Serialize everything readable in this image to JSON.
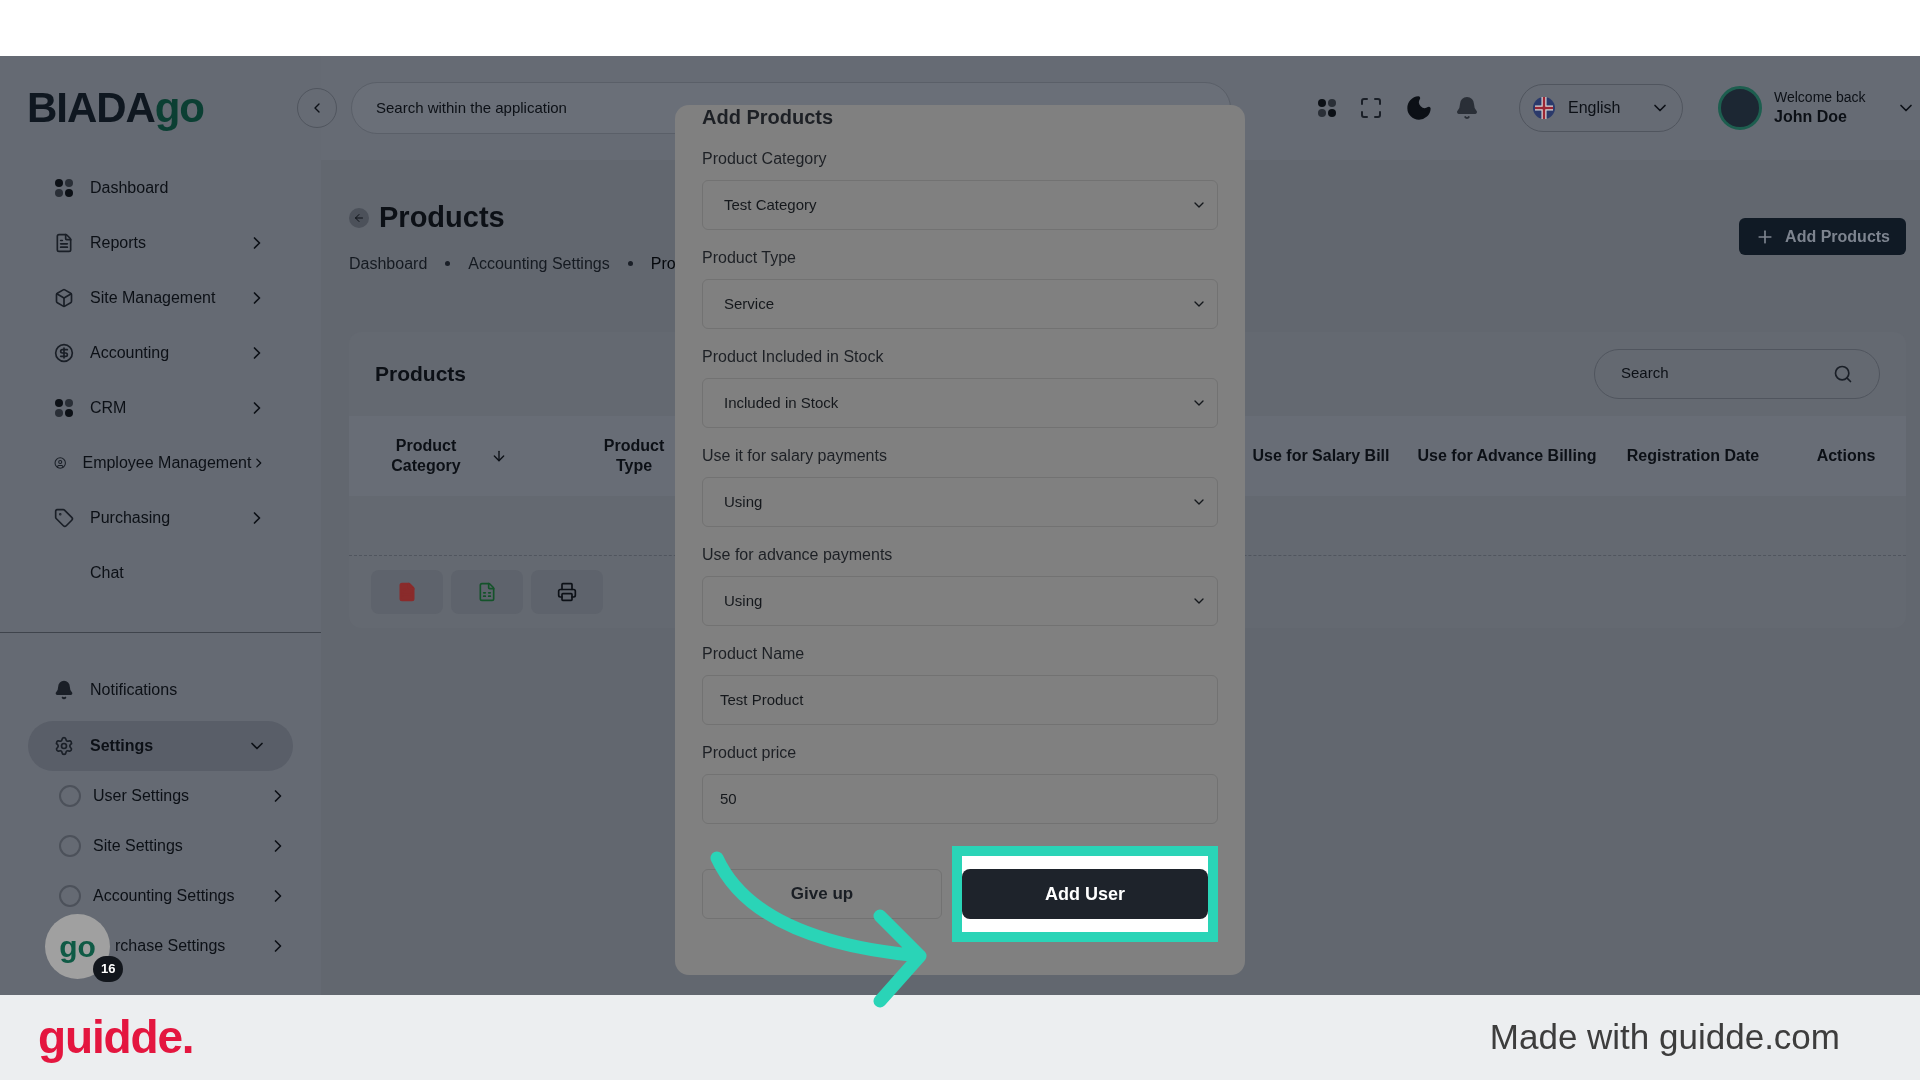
{
  "logo": {
    "part1": "BIADA",
    "part2": "go"
  },
  "header": {
    "search_placeholder": "Search within the application",
    "language": "English",
    "welcome": "Welcome back",
    "user_name": "John Doe"
  },
  "sidebar": {
    "items": [
      {
        "label": "Dashboard",
        "kind": "link",
        "selected": false
      },
      {
        "label": "Reports",
        "kind": "group",
        "selected": false
      },
      {
        "label": "Site Management",
        "kind": "group",
        "selected": false
      },
      {
        "label": "Accounting",
        "kind": "group",
        "selected": false
      },
      {
        "label": "CRM",
        "kind": "group",
        "selected": false
      },
      {
        "label": "Employee Management",
        "kind": "group",
        "selected": false
      },
      {
        "label": "Purchasing",
        "kind": "group",
        "selected": false
      },
      {
        "label": "Chat",
        "kind": "link",
        "selected": false
      }
    ],
    "bottom_items": [
      {
        "label": "Notifications",
        "kind": "link",
        "selected": false
      },
      {
        "label": "Settings",
        "kind": "group",
        "selected": true,
        "expanded": true,
        "children": [
          {
            "label": "User Settings"
          },
          {
            "label": "Site Settings"
          },
          {
            "label": "Accounting Settings"
          },
          {
            "label": "rchase Settings"
          }
        ]
      }
    ]
  },
  "page": {
    "title": "Products",
    "breadcrumbs": [
      "Dashboard",
      "Accounting Settings",
      "Pro"
    ],
    "add_button": "Add Products"
  },
  "table": {
    "title": "Products",
    "search_placeholder": "Search",
    "left_columns": [
      {
        "label": "Product Category"
      },
      {
        "label": "Product Type"
      }
    ],
    "right_columns": [
      {
        "label": "Use for Salary Bill"
      },
      {
        "label": "Use for Advance Billing"
      },
      {
        "label": "Registration Date"
      },
      {
        "label": "Actions"
      }
    ]
  },
  "chat_bubble": {
    "logo": "go",
    "badge": "16"
  },
  "modal": {
    "title": "Add Products",
    "fields": [
      {
        "label": "Product Category",
        "kind": "select",
        "value": "Test Category"
      },
      {
        "label": "Product Type",
        "kind": "select",
        "value": "Service"
      },
      {
        "label": "Product Included in Stock",
        "kind": "select",
        "value": "Included in Stock"
      },
      {
        "label": "Use it for salary payments",
        "kind": "select",
        "value": "Using"
      },
      {
        "label": "Use for advance payments",
        "kind": "select",
        "value": "Using"
      },
      {
        "label": "Product Name",
        "kind": "input",
        "value": "Test Product"
      },
      {
        "label": "Product price",
        "kind": "input",
        "value": "50"
      }
    ],
    "cancel_button": "Give up",
    "submit_button": "Add User"
  },
  "footer": {
    "brand": "guidde.",
    "tagline": "Made with guidde.com"
  }
}
